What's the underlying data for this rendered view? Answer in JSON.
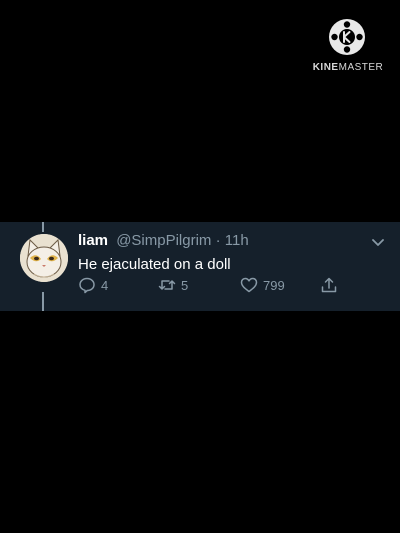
{
  "watermark": {
    "brand_bold": "KINE",
    "brand_rest": "MASTER",
    "logo_icon": "kinemaster-logo-icon"
  },
  "tweet": {
    "name": "liam",
    "handle": "@SimpPilgrim",
    "separator": "·",
    "time": "11h",
    "text": "He ejaculated on a doll",
    "avatar_icon": "cat-avatar",
    "menu_icon": "chevron-down-icon",
    "actions": {
      "reply_count": "4",
      "retweet_count": "5",
      "like_count": "799"
    }
  },
  "colors": {
    "background": "#000000",
    "tweet_bg": "#15202b",
    "secondary_text": "#8899a6",
    "primary_text": "#ffffff"
  }
}
